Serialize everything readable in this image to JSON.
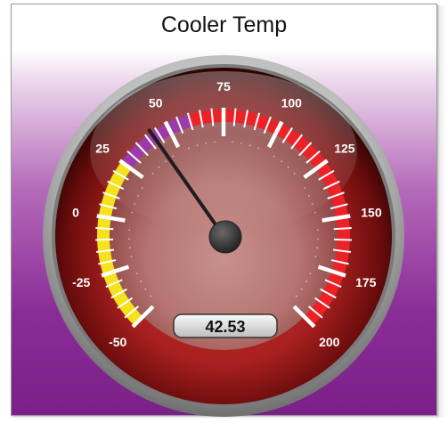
{
  "title": "Cooler Temp",
  "gauge": {
    "min": -50,
    "max": 200,
    "major_step": 25,
    "minor_per_major": 5,
    "value": 42.53,
    "value_text": "42.53",
    "tick_labels": [
      "-50",
      "-25",
      "0",
      "25",
      "50",
      "75",
      "100",
      "125",
      "150",
      "175",
      "200"
    ],
    "ranges": [
      {
        "from": -50,
        "to": 25,
        "color": "#f5e21c"
      },
      {
        "from": 25,
        "to": 60,
        "color": "#9b3aa8"
      },
      {
        "from": 60,
        "to": 200,
        "color": "#ec2226"
      }
    ],
    "colors": {
      "face": "#a52226",
      "bezel": "#9a9a9a",
      "needle": "#222222",
      "hub": "#3c3c3c"
    }
  }
}
